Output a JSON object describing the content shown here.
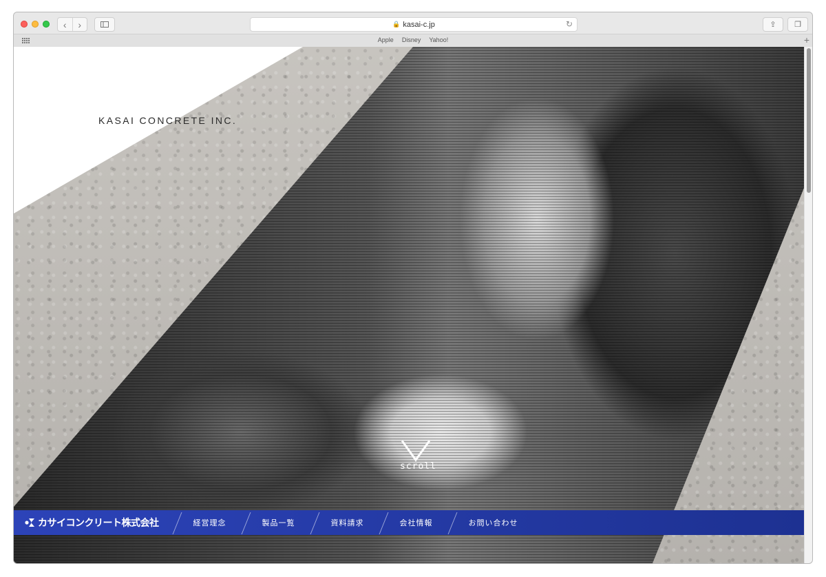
{
  "browser": {
    "url": "kasai-c.jp",
    "bookmarks": [
      "Apple",
      "Disney",
      "Yahoo!"
    ],
    "icons": {
      "back": "chevron-left-icon",
      "forward": "chevron-right-icon",
      "sidebar": "sidebar-icon",
      "lock": "lock-icon",
      "reload": "reload-icon",
      "share": "share-icon",
      "tabs": "tabs-icon",
      "add": "plus-icon"
    }
  },
  "hero": {
    "brand": "KASAI CONCRETE INC.",
    "scroll_label": "scroll"
  },
  "nav": {
    "logo_text": "カサイコンクリート株式会社",
    "items": [
      "経営理念",
      "製品一覧",
      "資料請求",
      "会社情報",
      "お問い合わせ"
    ]
  },
  "colors": {
    "nav_blue": "#2c43b8",
    "nav_blue_dark": "#1d3192"
  }
}
